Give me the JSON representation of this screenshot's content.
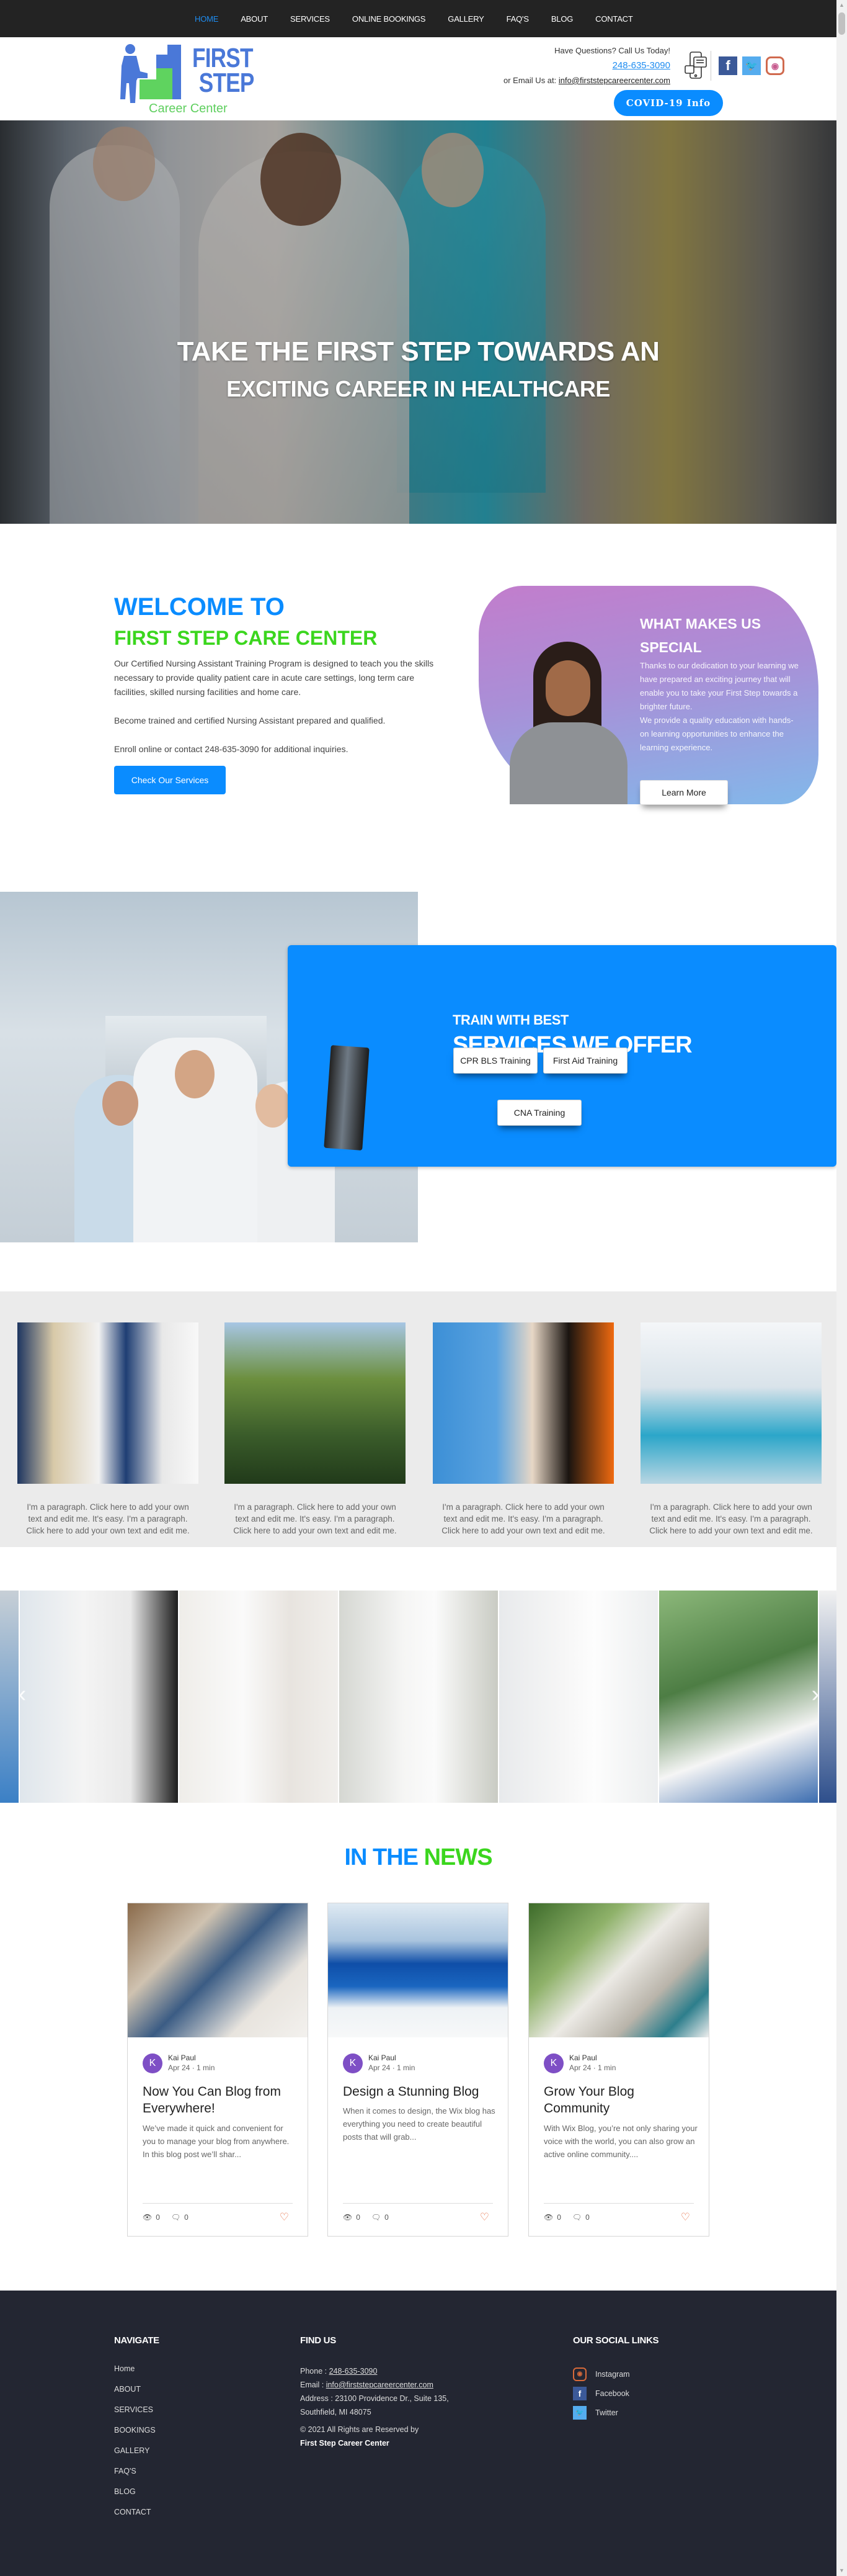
{
  "nav": {
    "items": [
      {
        "label": "HOME",
        "active": true
      },
      {
        "label": "ABOUT",
        "active": false
      },
      {
        "label": "SERVICES",
        "active": false
      },
      {
        "label": "ONLINE BOOKINGS",
        "active": false
      },
      {
        "label": "GALLERY",
        "active": false
      },
      {
        "label": "FAQ'S",
        "active": false
      },
      {
        "label": "BLOG",
        "active": false
      },
      {
        "label": "CONTACT",
        "active": false
      }
    ]
  },
  "header": {
    "logo": {
      "line1": "FIRST",
      "line2": "STEP",
      "tagline": "Career Center"
    },
    "questions": "Have Questions? Call Us Today!",
    "phone": "248-635-3090",
    "email_prefix": "or Email Us at:",
    "email": "info@firststepcareercenter.com",
    "covid_button": "COVID-19 Info",
    "icons": [
      "chat-phone-icon",
      "facebook-icon",
      "twitter-icon",
      "instagram-icon"
    ]
  },
  "hero": {
    "line1": "TAKE THE FIRST STEP TOWARDS AN",
    "line2": "EXCITING CAREER IN HEALTHCARE"
  },
  "welcome": {
    "title1": "WELCOME TO",
    "title2": "FIRST STEP CARE CENTER",
    "para1": "Our Certified Nursing Assistant Training Program is designed to teach you the skills necessary to provide quality patient care in acute care settings, long term care facilities, skilled nursing facilities and home care.",
    "para2": "Become trained and certified Nursing Assistant prepared and qualified.",
    "para3": "Enroll online or contact 248-635-3090 for additional inquiries.",
    "button": "Check Our Services"
  },
  "special": {
    "title": "WHAT MAKES US SPECIAL",
    "para1": "Thanks to our dedication to your learning we have prepared an exciting journey that will enable you to take your First Step towards a brighter future.",
    "para2": "We provide a quality education with hands-on learning opportunities to enhance the learning experience.",
    "button": "Learn More"
  },
  "services": {
    "kicker": "TRAIN WITH BEST",
    "title": "SERVICES WE OFFER",
    "buttons": [
      "CPR BLS Training",
      "First Aid Training",
      "CNA Training"
    ]
  },
  "features": {
    "cards": [
      {
        "text": "I'm a paragraph. Click here to add your own text and edit me. It's easy. I'm a paragraph. Click here to add your own text and edit me."
      },
      {
        "text": "I'm a paragraph. Click here to add your own text and edit me. It's easy. I'm a paragraph. Click here to add your own text and edit me."
      },
      {
        "text": "I'm a paragraph. Click here to add your own text and edit me. It's easy. I'm a paragraph. Click here to add your own text and edit me."
      },
      {
        "text": "I'm a paragraph. Click here to add your own text and edit me. It's easy. I'm a paragraph. Click here to add your own text and edit me."
      }
    ]
  },
  "gallery": {
    "prev_arrow": "‹",
    "next_arrow": "›"
  },
  "news": {
    "title_a": "IN THE",
    "title_b": "NEWS",
    "posts": [
      {
        "author_initial": "K",
        "author": "Kai Paul",
        "date": "Apr 24",
        "read": "1 min",
        "title": "Now You Can Blog from Everywhere!",
        "excerpt": "We’ve made it quick and convenient for you to manage your blog from anywhere. In this blog post we’ll shar...",
        "views": "0",
        "comments": "0"
      },
      {
        "author_initial": "K",
        "author": "Kai Paul",
        "date": "Apr 24",
        "read": "1 min",
        "title": "Design a Stunning Blog",
        "excerpt": "When it comes to design, the Wix blog has everything you need to create beautiful posts that will grab...",
        "views": "0",
        "comments": "0"
      },
      {
        "author_initial": "K",
        "author": "Kai Paul",
        "date": "Apr 24",
        "read": "1 min",
        "title": "Grow Your Blog Community",
        "excerpt": "With Wix Blog, you’re not only sharing your voice with the world, you can also grow an active online community....",
        "views": "0",
        "comments": "0"
      }
    ]
  },
  "footer": {
    "navigate": {
      "heading": "NAVIGATE",
      "items": [
        "Home",
        "ABOUT",
        "SERVICES",
        "BOOKINGS",
        "GALLERY",
        "FAQ'S",
        "BLOG",
        "CONTACT"
      ]
    },
    "find": {
      "heading": "FIND US",
      "phone_label": "Phone :",
      "phone": "248-635-3090",
      "email_label": "Email :",
      "email": "info@firststepcareercenter.com",
      "address": "Address : 23100 Providence Dr., Suite 135, Southfield, MI 48075",
      "copyright": "© 2021 All Rights are Reserved by",
      "org": "First Step Career Center"
    },
    "social": {
      "heading": "OUR SOCIAL LINKS",
      "items": [
        {
          "label": "Instagram",
          "icon": "instagram-icon"
        },
        {
          "label": "Facebook",
          "icon": "facebook-icon"
        },
        {
          "label": "Twitter",
          "icon": "twitter-icon"
        }
      ]
    }
  },
  "colors": {
    "accent_blue": "#0a8cff",
    "accent_green": "#3bd61e",
    "nav_bg": "#232323",
    "footer_bg": "#232632",
    "heart": "#e8734a"
  }
}
